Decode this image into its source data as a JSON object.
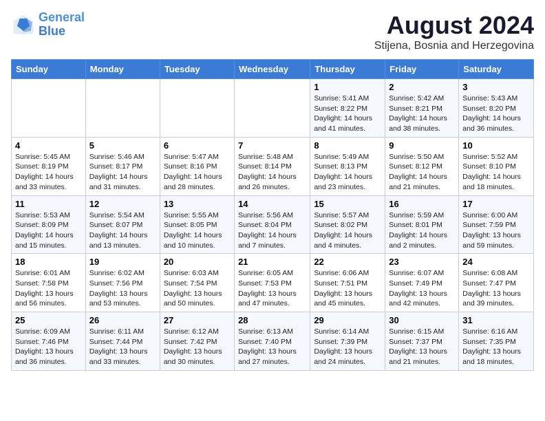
{
  "logo": {
    "line1": "General",
    "line2": "Blue"
  },
  "title": "August 2024",
  "subtitle": "Stijena, Bosnia and Herzegovina",
  "days_of_week": [
    "Sunday",
    "Monday",
    "Tuesday",
    "Wednesday",
    "Thursday",
    "Friday",
    "Saturday"
  ],
  "weeks": [
    [
      {
        "day": "",
        "info": ""
      },
      {
        "day": "",
        "info": ""
      },
      {
        "day": "",
        "info": ""
      },
      {
        "day": "",
        "info": ""
      },
      {
        "day": "1",
        "info": "Sunrise: 5:41 AM\nSunset: 8:22 PM\nDaylight: 14 hours and 41 minutes."
      },
      {
        "day": "2",
        "info": "Sunrise: 5:42 AM\nSunset: 8:21 PM\nDaylight: 14 hours and 38 minutes."
      },
      {
        "day": "3",
        "info": "Sunrise: 5:43 AM\nSunset: 8:20 PM\nDaylight: 14 hours and 36 minutes."
      }
    ],
    [
      {
        "day": "4",
        "info": "Sunrise: 5:45 AM\nSunset: 8:19 PM\nDaylight: 14 hours and 33 minutes."
      },
      {
        "day": "5",
        "info": "Sunrise: 5:46 AM\nSunset: 8:17 PM\nDaylight: 14 hours and 31 minutes."
      },
      {
        "day": "6",
        "info": "Sunrise: 5:47 AM\nSunset: 8:16 PM\nDaylight: 14 hours and 28 minutes."
      },
      {
        "day": "7",
        "info": "Sunrise: 5:48 AM\nSunset: 8:14 PM\nDaylight: 14 hours and 26 minutes."
      },
      {
        "day": "8",
        "info": "Sunrise: 5:49 AM\nSunset: 8:13 PM\nDaylight: 14 hours and 23 minutes."
      },
      {
        "day": "9",
        "info": "Sunrise: 5:50 AM\nSunset: 8:12 PM\nDaylight: 14 hours and 21 minutes."
      },
      {
        "day": "10",
        "info": "Sunrise: 5:52 AM\nSunset: 8:10 PM\nDaylight: 14 hours and 18 minutes."
      }
    ],
    [
      {
        "day": "11",
        "info": "Sunrise: 5:53 AM\nSunset: 8:09 PM\nDaylight: 14 hours and 15 minutes."
      },
      {
        "day": "12",
        "info": "Sunrise: 5:54 AM\nSunset: 8:07 PM\nDaylight: 14 hours and 13 minutes."
      },
      {
        "day": "13",
        "info": "Sunrise: 5:55 AM\nSunset: 8:05 PM\nDaylight: 14 hours and 10 minutes."
      },
      {
        "day": "14",
        "info": "Sunrise: 5:56 AM\nSunset: 8:04 PM\nDaylight: 14 hours and 7 minutes."
      },
      {
        "day": "15",
        "info": "Sunrise: 5:57 AM\nSunset: 8:02 PM\nDaylight: 14 hours and 4 minutes."
      },
      {
        "day": "16",
        "info": "Sunrise: 5:59 AM\nSunset: 8:01 PM\nDaylight: 14 hours and 2 minutes."
      },
      {
        "day": "17",
        "info": "Sunrise: 6:00 AM\nSunset: 7:59 PM\nDaylight: 13 hours and 59 minutes."
      }
    ],
    [
      {
        "day": "18",
        "info": "Sunrise: 6:01 AM\nSunset: 7:58 PM\nDaylight: 13 hours and 56 minutes."
      },
      {
        "day": "19",
        "info": "Sunrise: 6:02 AM\nSunset: 7:56 PM\nDaylight: 13 hours and 53 minutes."
      },
      {
        "day": "20",
        "info": "Sunrise: 6:03 AM\nSunset: 7:54 PM\nDaylight: 13 hours and 50 minutes."
      },
      {
        "day": "21",
        "info": "Sunrise: 6:05 AM\nSunset: 7:53 PM\nDaylight: 13 hours and 47 minutes."
      },
      {
        "day": "22",
        "info": "Sunrise: 6:06 AM\nSunset: 7:51 PM\nDaylight: 13 hours and 45 minutes."
      },
      {
        "day": "23",
        "info": "Sunrise: 6:07 AM\nSunset: 7:49 PM\nDaylight: 13 hours and 42 minutes."
      },
      {
        "day": "24",
        "info": "Sunrise: 6:08 AM\nSunset: 7:47 PM\nDaylight: 13 hours and 39 minutes."
      }
    ],
    [
      {
        "day": "25",
        "info": "Sunrise: 6:09 AM\nSunset: 7:46 PM\nDaylight: 13 hours and 36 minutes."
      },
      {
        "day": "26",
        "info": "Sunrise: 6:11 AM\nSunset: 7:44 PM\nDaylight: 13 hours and 33 minutes."
      },
      {
        "day": "27",
        "info": "Sunrise: 6:12 AM\nSunset: 7:42 PM\nDaylight: 13 hours and 30 minutes."
      },
      {
        "day": "28",
        "info": "Sunrise: 6:13 AM\nSunset: 7:40 PM\nDaylight: 13 hours and 27 minutes."
      },
      {
        "day": "29",
        "info": "Sunrise: 6:14 AM\nSunset: 7:39 PM\nDaylight: 13 hours and 24 minutes."
      },
      {
        "day": "30",
        "info": "Sunrise: 6:15 AM\nSunset: 7:37 PM\nDaylight: 13 hours and 21 minutes."
      },
      {
        "day": "31",
        "info": "Sunrise: 6:16 AM\nSunset: 7:35 PM\nDaylight: 13 hours and 18 minutes."
      }
    ]
  ]
}
